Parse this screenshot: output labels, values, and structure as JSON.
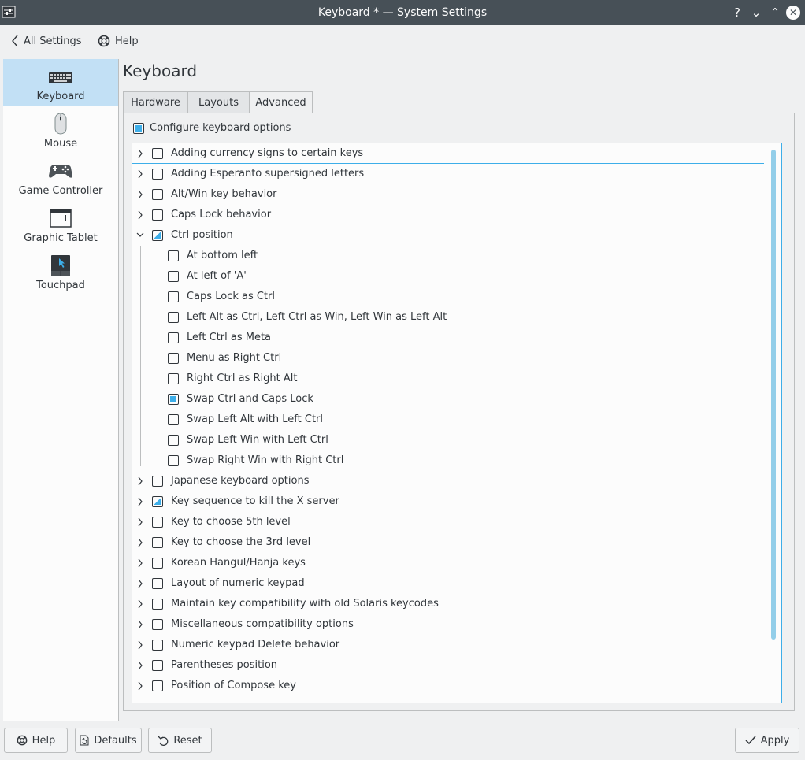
{
  "window": {
    "title": "Keyboard * — System Settings",
    "help_glyph": "?",
    "min_glyph": "⌄",
    "max_glyph": "⌃",
    "close_glyph": "✕"
  },
  "toolbar": {
    "back_label": "All Settings",
    "help_label": "Help"
  },
  "sidebar": {
    "items": [
      {
        "label": "Keyboard",
        "icon": "keyboard-icon",
        "selected": true
      },
      {
        "label": "Mouse",
        "icon": "mouse-icon"
      },
      {
        "label": "Game Controller",
        "icon": "gamepad-icon"
      },
      {
        "label": "Graphic Tablet",
        "icon": "tablet-icon"
      },
      {
        "label": "Touchpad",
        "icon": "touchpad-icon"
      }
    ]
  },
  "main": {
    "title": "Keyboard",
    "tabs": [
      {
        "label": "Hardware"
      },
      {
        "label": "Layouts"
      },
      {
        "label": "Advanced",
        "active": true
      }
    ],
    "configure_label": "Configure keyboard options",
    "options": [
      {
        "label": "Adding currency signs to certain keys",
        "state": "unchecked"
      },
      {
        "label": "Adding Esperanto supersigned letters",
        "state": "unchecked"
      },
      {
        "label": "Alt/Win key behavior",
        "state": "unchecked"
      },
      {
        "label": "Caps Lock behavior",
        "state": "unchecked"
      },
      {
        "label": "Ctrl position",
        "state": "partial",
        "expanded": true
      },
      {
        "label": "At bottom left",
        "state": "unchecked",
        "child": true
      },
      {
        "label": "At left of 'A'",
        "state": "unchecked",
        "child": true
      },
      {
        "label": "Caps Lock as Ctrl",
        "state": "unchecked",
        "child": true
      },
      {
        "label": "Left Alt as Ctrl, Left Ctrl as Win, Left Win as Left Alt",
        "state": "unchecked",
        "child": true
      },
      {
        "label": "Left Ctrl as Meta",
        "state": "unchecked",
        "child": true
      },
      {
        "label": "Menu as Right Ctrl",
        "state": "unchecked",
        "child": true
      },
      {
        "label": "Right Ctrl as Right Alt",
        "state": "unchecked",
        "child": true
      },
      {
        "label": "Swap Ctrl and Caps Lock",
        "state": "checked",
        "child": true
      },
      {
        "label": "Swap Left Alt with Left Ctrl",
        "state": "unchecked",
        "child": true
      },
      {
        "label": "Swap Left Win with Left Ctrl",
        "state": "unchecked",
        "child": true
      },
      {
        "label": "Swap Right Win with Right Ctrl",
        "state": "unchecked",
        "child": true
      },
      {
        "label": "Japanese keyboard options",
        "state": "unchecked"
      },
      {
        "label": "Key sequence to kill the X server",
        "state": "partial"
      },
      {
        "label": "Key to choose 5th level",
        "state": "unchecked"
      },
      {
        "label": "Key to choose the 3rd level",
        "state": "unchecked"
      },
      {
        "label": "Korean Hangul/Hanja keys",
        "state": "unchecked"
      },
      {
        "label": "Layout of numeric keypad",
        "state": "unchecked"
      },
      {
        "label": "Maintain key compatibility with old Solaris keycodes",
        "state": "unchecked"
      },
      {
        "label": "Miscellaneous compatibility options",
        "state": "unchecked"
      },
      {
        "label": "Numeric keypad Delete behavior",
        "state": "unchecked"
      },
      {
        "label": "Parentheses position",
        "state": "unchecked"
      },
      {
        "label": "Position of Compose key",
        "state": "unchecked"
      }
    ]
  },
  "footer": {
    "help_label": "Help",
    "defaults_label": "Defaults",
    "reset_label": "Reset",
    "apply_label": "Apply"
  },
  "colors": {
    "accent": "#3daee9",
    "selection": "#c2e0f5",
    "titlebar": "#475057"
  }
}
